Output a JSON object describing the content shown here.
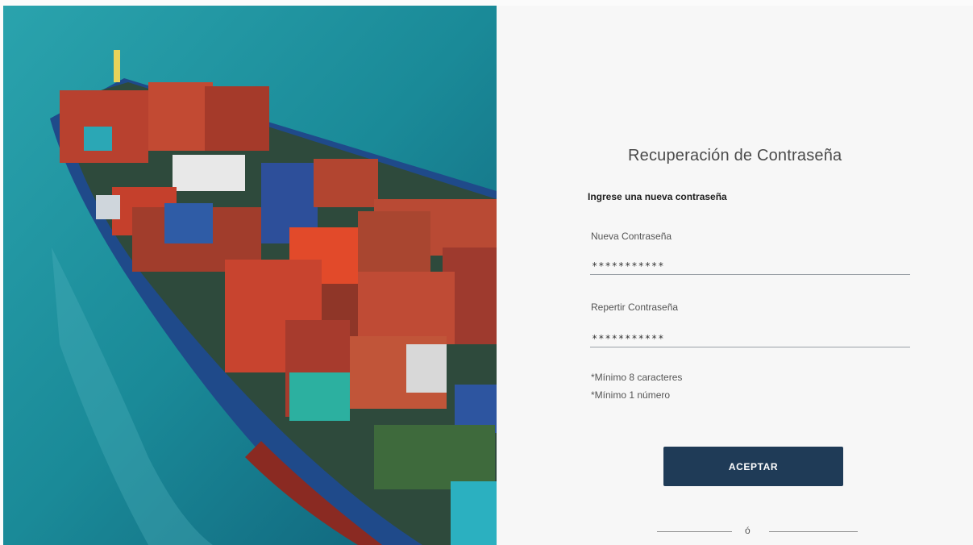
{
  "hero": {
    "image": "cargo-ship-aerial-photo"
  },
  "form": {
    "title": "Recuperación de Contraseña",
    "subtitle": "Ingrese una nueva contraseña",
    "new_password": {
      "label": "Nueva Contraseña",
      "value": "***********"
    },
    "repeat_password": {
      "label": "Repertir Contraseña",
      "value": "***********"
    },
    "hints": [
      "*Mínimo 8 caracteres",
      "*Mínimo 1 número"
    ],
    "accept_label": "ACEPTAR",
    "divider_text": "ó"
  },
  "colors": {
    "accent": "#1f3b57",
    "background": "#f7f7f7",
    "sea": "#1f8a9a"
  }
}
